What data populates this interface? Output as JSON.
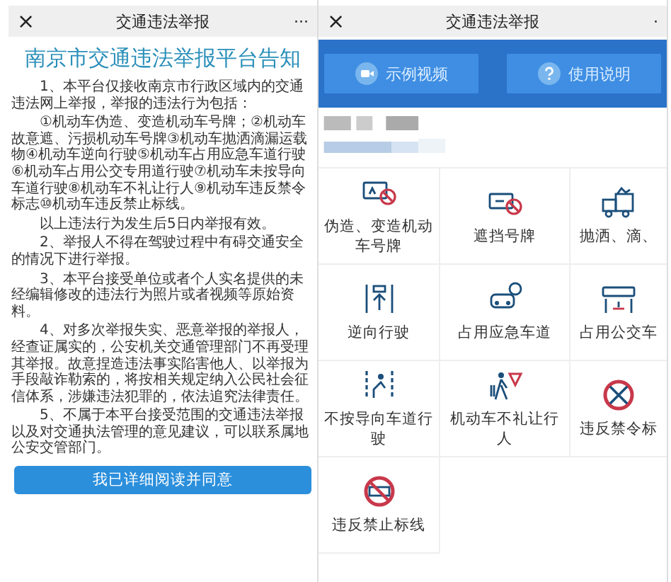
{
  "notice_screen": {
    "header": {
      "close": "×",
      "title": "交通违法举报",
      "more": "···"
    },
    "title": "南京市交通违法举报平台告知",
    "paragraphs": [
      "1、本平台仅接收南京市行政区域内的交通违法网上举报，举报的违法行为包括：",
      "①机动车伪造、变造机动车号牌；②机动车故意遮、污损机动车号牌③机动车抛洒滴漏运载物④机动车逆向行驶⑤机动车占用应急车道行驶⑥机动车占用公交专用道行驶⑦机动车未按导向车道行驶⑧机动车不礼让行人⑨机动车违反禁令标志⑩机动车违反禁止标线。",
      "以上违法行为发生后5日内举报有效。",
      "2、举报人不得在驾驶过程中有碍交通安全的情况下进行举报。",
      "3、本平台接受单位或者个人实名提供的未经编辑修改的违法行为照片或者视频等原始资料。",
      "4、对多次举报失实、恶意举报的举报人，经查证属实的，公安机关交通管理部门不再受理其举报。故意捏造违法事实陷害他人、以举报为手段敲诈勒索的，将按相关规定纳入公民社会征信体系，涉嫌违法犯罪的，依法追究法律责任。",
      "5、不属于本平台接受范围的交通违法举报以及对交通执法管理的意见建议，可以联系属地公安交管部门。"
    ],
    "agree_button": "我已详细阅读并同意"
  },
  "report_screen": {
    "header": {
      "close": "×",
      "title": "交通违法举报",
      "more": "·"
    },
    "buttons": [
      {
        "label": "示例视频",
        "kind": "video"
      },
      {
        "label": "使用说明",
        "kind": "help"
      }
    ],
    "violations": [
      {
        "label": "伪造、变造机动车号牌"
      },
      {
        "label": "遮挡号牌"
      },
      {
        "label": "抛洒、滴、"
      },
      {
        "label": "逆向行驶"
      },
      {
        "label": "占用应急车道"
      },
      {
        "label": "占用公交车"
      },
      {
        "label": "不按导向车道行驶"
      },
      {
        "label": "机动车不礼让行人"
      },
      {
        "label": "违反禁令标"
      },
      {
        "label": "违反禁止标线"
      }
    ]
  }
}
